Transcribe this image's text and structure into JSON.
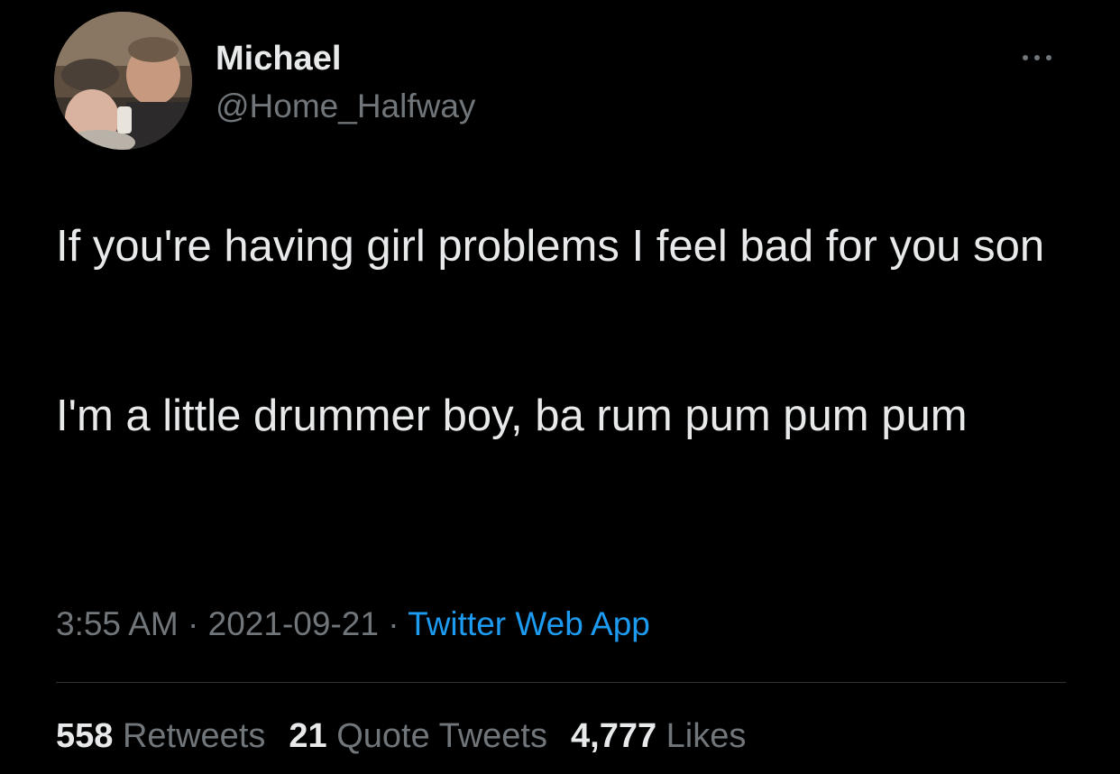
{
  "author": {
    "display_name": "Michael",
    "handle": "@Home_Halfway"
  },
  "tweet": {
    "paragraphs": [
      "If you're having girl problems I feel bad for you son",
      "I'm a little drummer boy, ba rum pum pum pum"
    ],
    "time": "3:55 AM",
    "separator": "·",
    "date": "2021-09-21",
    "source": "Twitter Web App"
  },
  "stats": {
    "retweets_count": "558",
    "retweets_label": "Retweets",
    "quotes_count": "21",
    "quotes_label": "Quote Tweets",
    "likes_count": "4,777",
    "likes_label": "Likes"
  },
  "icons": {
    "more": "more-horizontal-icon"
  },
  "colors": {
    "background": "#000000",
    "primary_text": "#e7e9ea",
    "secondary_text": "#71767b",
    "link": "#1d9bf0",
    "divider": "#2f3336"
  }
}
